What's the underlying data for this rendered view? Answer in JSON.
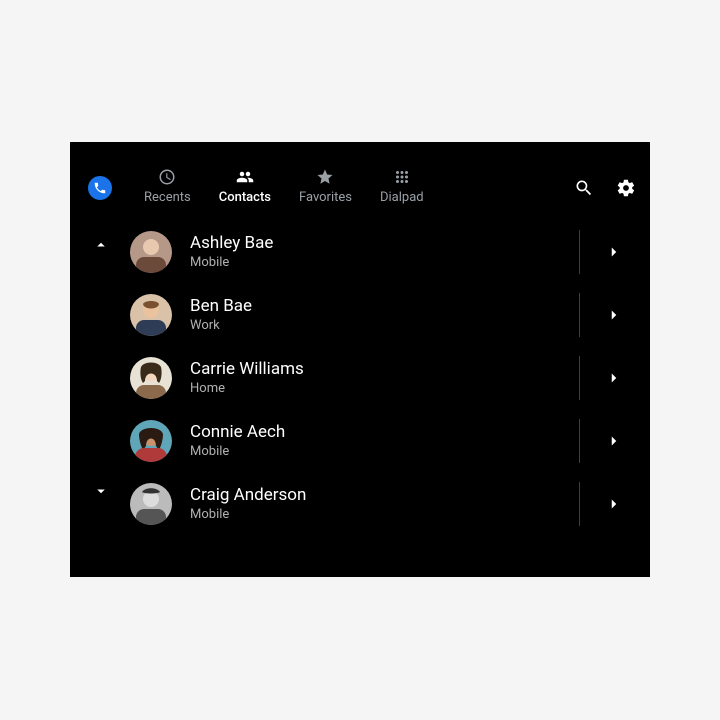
{
  "tabs": {
    "recents": "Recents",
    "contacts": "Contacts",
    "favorites": "Favorites",
    "dialpad": "Dialpad"
  },
  "active_tab": "contacts",
  "contacts": [
    {
      "name": "Ashley Bae",
      "label": "Mobile"
    },
    {
      "name": "Ben Bae",
      "label": "Work"
    },
    {
      "name": "Carrie Williams",
      "label": "Home"
    },
    {
      "name": "Connie Aech",
      "label": "Mobile"
    },
    {
      "name": "Craig Anderson",
      "label": "Mobile"
    }
  ]
}
